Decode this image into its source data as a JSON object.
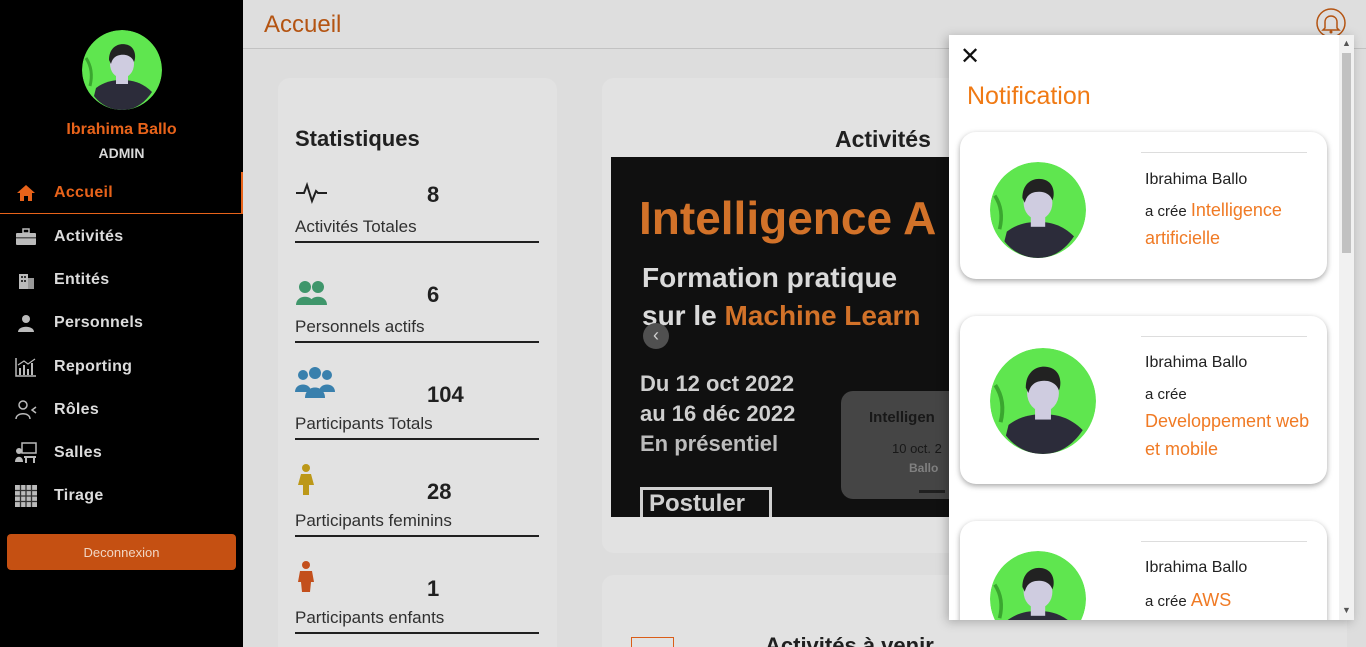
{
  "user": {
    "name": "Ibrahima Ballo",
    "role": "ADMIN"
  },
  "sidebar": {
    "items": [
      {
        "label": "Accueil",
        "icon": "home-icon",
        "active": true
      },
      {
        "label": "Activités",
        "icon": "briefcase-icon"
      },
      {
        "label": "Entités",
        "icon": "building-icon"
      },
      {
        "label": "Personnels",
        "icon": "user-icon"
      },
      {
        "label": "Reporting",
        "icon": "chart-icon"
      },
      {
        "label": "Rôles",
        "icon": "user-role-icon"
      },
      {
        "label": "Salles",
        "icon": "room-icon"
      },
      {
        "label": "Tirage",
        "icon": "grid-icon"
      }
    ],
    "logout_label": "Deconnexion"
  },
  "header": {
    "title": "Accueil",
    "bell_icon": "bell-icon"
  },
  "stats": {
    "title": "Statistiques",
    "items": [
      {
        "value": "8",
        "label": "Activités Totales",
        "icon": "activity-icon"
      },
      {
        "value": "6",
        "label": "Personnels actifs",
        "icon": "users-icon"
      },
      {
        "value": "104",
        "label": "Participants Totals",
        "icon": "group-icon"
      },
      {
        "value": "28",
        "label": "Participants feminins",
        "icon": "female-icon"
      },
      {
        "value": "1",
        "label": "Participants enfants",
        "icon": "child-icon"
      }
    ]
  },
  "activities": {
    "title": "Activités",
    "banner": {
      "title": "Intelligence A",
      "subtitle_line1": "Formation pratique",
      "subtitle_prefix": "sur le ",
      "subtitle_highlight": "Machine Learn",
      "date_line1": "Du 12 oct 2022",
      "date_line2": "au 16 déc 2022",
      "place": "En présentiel",
      "button": "Postuler",
      "mini_title": "Intelligen",
      "mini_date": "10 oct. 2",
      "mini_who": "Ballo"
    },
    "upcoming_title": "Activités à venir"
  },
  "notifications": {
    "title": "Notification",
    "close": "✕",
    "items": [
      {
        "name": "Ibrahima Ballo",
        "prefix": "a crée",
        "activity": "Intelligence artificielle"
      },
      {
        "name": "Ibrahima Ballo",
        "prefix": "a crée",
        "activity": "Developpement web et mobile"
      },
      {
        "name": "Ibrahima Ballo",
        "prefix": "a crée",
        "activity": "AWS"
      }
    ]
  },
  "colors": {
    "accent": "#e8631a",
    "sidebar_bg": "#000000",
    "avatar_green": "#5fe64f"
  }
}
